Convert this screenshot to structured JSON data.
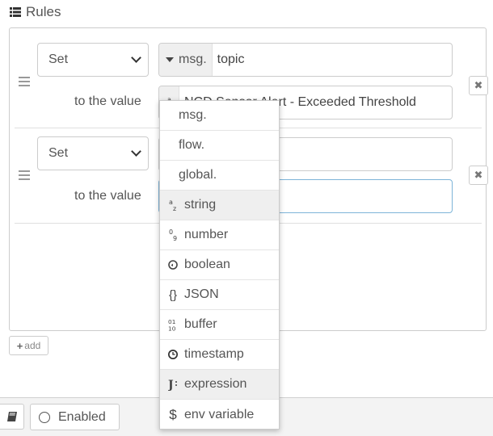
{
  "header": {
    "title": "Rules",
    "icon": "list-icon"
  },
  "rules": [
    {
      "action": "Set",
      "target_type": "msg.",
      "target_value": "topic",
      "value_label": "to the value",
      "value_type_icon": "string-az-icon",
      "value": "NCD Sensor Alert - Exceeded Threshold"
    },
    {
      "action": "Set",
      "target_type": "",
      "target_value": "",
      "value_label": "to the value",
      "value": ""
    }
  ],
  "add_button": {
    "label": "add"
  },
  "footer": {
    "enabled_label": "Enabled"
  },
  "type_menu": {
    "items": [
      {
        "label": "msg.",
        "icon": ""
      },
      {
        "label": "flow.",
        "icon": ""
      },
      {
        "label": "global.",
        "icon": ""
      },
      {
        "label": "string",
        "icon": "string-az-icon"
      },
      {
        "label": "number",
        "icon": "number-09-icon"
      },
      {
        "label": "boolean",
        "icon": "boolean-icon"
      },
      {
        "label": "JSON",
        "icon": "json-braces-icon"
      },
      {
        "label": "buffer",
        "icon": "buffer-binary-icon"
      },
      {
        "label": "timestamp",
        "icon": "clock-icon"
      },
      {
        "label": "expression",
        "icon": "jsonata-icon"
      },
      {
        "label": "env variable",
        "icon": "dollar-icon"
      }
    ],
    "highlighted": [
      "string",
      "expression"
    ]
  }
}
